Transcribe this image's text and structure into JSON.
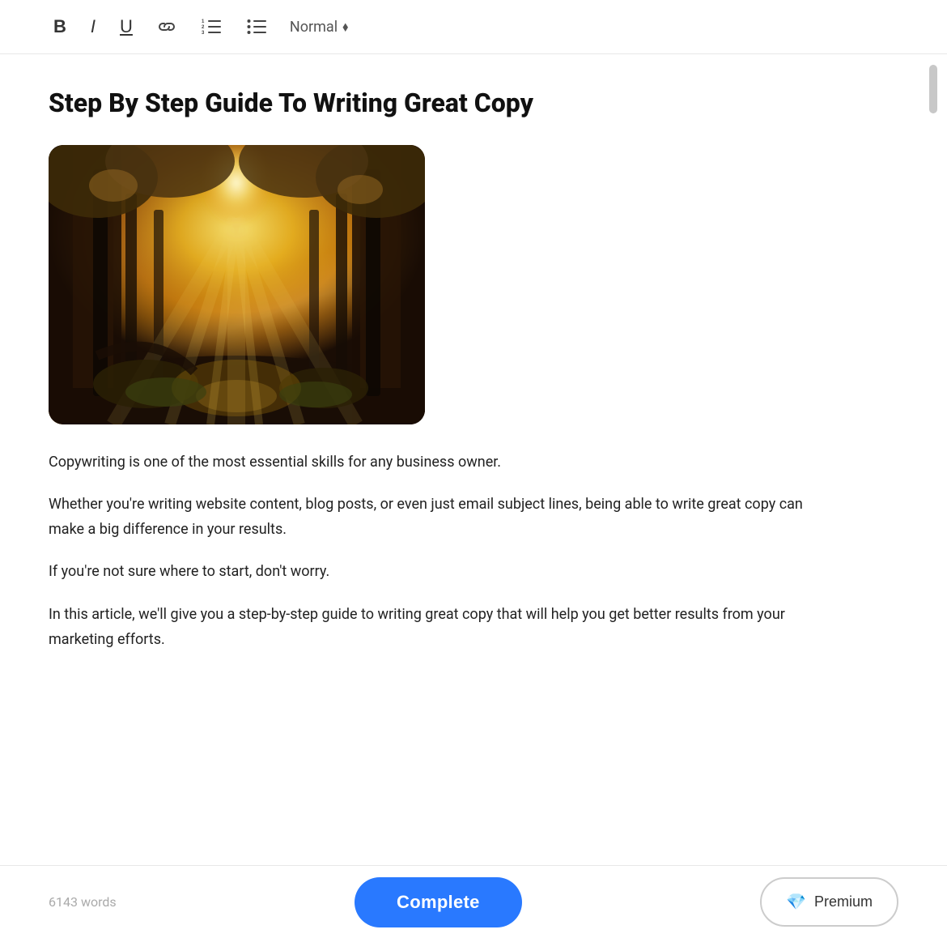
{
  "toolbar": {
    "bold_label": "B",
    "italic_label": "I",
    "underline_label": "U",
    "style_label": "Normal",
    "style_arrow": "⬦"
  },
  "article": {
    "title": "Step By Step Guide To Writing Great Copy",
    "paragraphs": [
      "Copywriting is one of the most essential skills for any business owner.",
      "Whether you're writing website content, blog posts, or even just email subject lines, being able to write great copy can make a big difference in your results.",
      "If you're not sure where to start, don't worry.",
      "In this article, we'll give you a step-by-step guide to writing great copy that will help you get better results from your marketing efforts."
    ]
  },
  "bottom_bar": {
    "word_count": "6143 words",
    "complete_label": "Complete",
    "premium_label": "Premium"
  }
}
